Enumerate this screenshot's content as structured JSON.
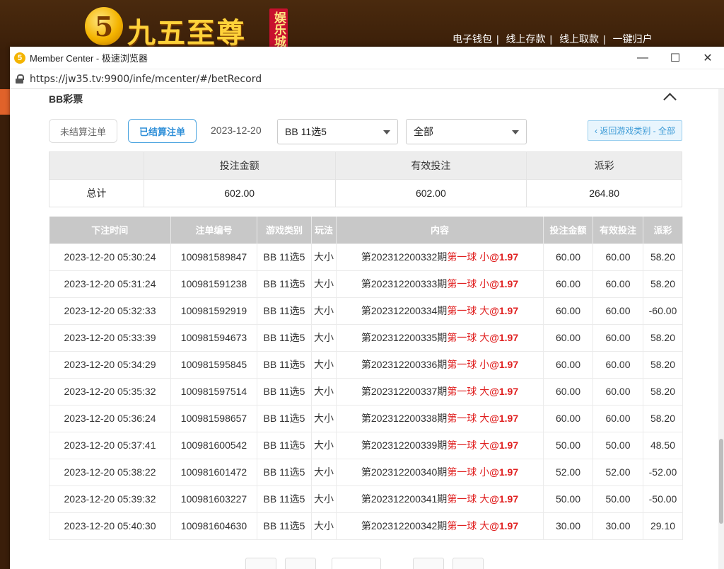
{
  "site": {
    "logo_text": "九五至尊",
    "logo_badge": "娱乐城",
    "nav": [
      "电子钱包",
      "线上存款",
      "线上取款",
      "一键归户"
    ]
  },
  "window": {
    "title": "Member Center - 极速浏览器",
    "url": "https://jw35.tv:9900/infe/mcenter/#/betRecord"
  },
  "section": {
    "title": "BB彩票"
  },
  "filters": {
    "unsettled_label": "未结算注单",
    "settled_label": "已结算注单",
    "date": "2023-12-20",
    "game_select": "BB 11选5",
    "type_select": "全部",
    "back_label": "‹ 返回游戏类别 - 全部"
  },
  "summary": {
    "headers": [
      "投注金额",
      "有效投注",
      "派彩"
    ],
    "row_label": "总计",
    "values": [
      "602.00",
      "602.00",
      "264.80"
    ]
  },
  "records": {
    "headers": [
      "下注时间",
      "注单编号",
      "游戏类别",
      "玩法",
      "内容",
      "投注金额",
      "有效投注",
      "派彩"
    ],
    "rows": [
      {
        "time": "2023-12-20 05:30:24",
        "id": "100981589847",
        "game": "BB 11选5",
        "play": "大小",
        "period": "第202312200332期",
        "pick": "第一球 小",
        "odds": "@1.97",
        "bet": "60.00",
        "valid": "60.00",
        "payout": "58.20",
        "negative": false
      },
      {
        "time": "2023-12-20 05:31:24",
        "id": "100981591238",
        "game": "BB 11选5",
        "play": "大小",
        "period": "第202312200333期",
        "pick": "第一球 小",
        "odds": "@1.97",
        "bet": "60.00",
        "valid": "60.00",
        "payout": "58.20",
        "negative": false
      },
      {
        "time": "2023-12-20 05:32:33",
        "id": "100981592919",
        "game": "BB 11选5",
        "play": "大小",
        "period": "第202312200334期",
        "pick": "第一球 大",
        "odds": "@1.97",
        "bet": "60.00",
        "valid": "60.00",
        "payout": "-60.00",
        "negative": true
      },
      {
        "time": "2023-12-20 05:33:39",
        "id": "100981594673",
        "game": "BB 11选5",
        "play": "大小",
        "period": "第202312200335期",
        "pick": "第一球 大",
        "odds": "@1.97",
        "bet": "60.00",
        "valid": "60.00",
        "payout": "58.20",
        "negative": false
      },
      {
        "time": "2023-12-20 05:34:29",
        "id": "100981595845",
        "game": "BB 11选5",
        "play": "大小",
        "period": "第202312200336期",
        "pick": "第一球 小",
        "odds": "@1.97",
        "bet": "60.00",
        "valid": "60.00",
        "payout": "58.20",
        "negative": false
      },
      {
        "time": "2023-12-20 05:35:32",
        "id": "100981597514",
        "game": "BB 11选5",
        "play": "大小",
        "period": "第202312200337期",
        "pick": "第一球 大",
        "odds": "@1.97",
        "bet": "60.00",
        "valid": "60.00",
        "payout": "58.20",
        "negative": false
      },
      {
        "time": "2023-12-20 05:36:24",
        "id": "100981598657",
        "game": "BB 11选5",
        "play": "大小",
        "period": "第202312200338期",
        "pick": "第一球 大",
        "odds": "@1.97",
        "bet": "60.00",
        "valid": "60.00",
        "payout": "58.20",
        "negative": false
      },
      {
        "time": "2023-12-20 05:37:41",
        "id": "100981600542",
        "game": "BB 11选5",
        "play": "大小",
        "period": "第202312200339期",
        "pick": "第一球 大",
        "odds": "@1.97",
        "bet": "50.00",
        "valid": "50.00",
        "payout": "48.50",
        "negative": false
      },
      {
        "time": "2023-12-20 05:38:22",
        "id": "100981601472",
        "game": "BB 11选5",
        "play": "大小",
        "period": "第202312200340期",
        "pick": "第一球 小",
        "odds": "@1.97",
        "bet": "52.00",
        "valid": "52.00",
        "payout": "-52.00",
        "negative": true
      },
      {
        "time": "2023-12-20 05:39:32",
        "id": "100981603227",
        "game": "BB 11选5",
        "play": "大小",
        "period": "第202312200341期",
        "pick": "第一球 大",
        "odds": "@1.97",
        "bet": "50.00",
        "valid": "50.00",
        "payout": "-50.00",
        "negative": true
      },
      {
        "time": "2023-12-20 05:40:30",
        "id": "100981604630",
        "game": "BB 11选5",
        "play": "大小",
        "period": "第202312200342期",
        "pick": "第一球 大",
        "odds": "@1.97",
        "bet": "30.00",
        "valid": "30.00",
        "payout": "29.10",
        "negative": false
      }
    ]
  },
  "colors": {
    "accent": "#2f8fd8",
    "highlight": "#e02020",
    "header_bg": "#c8c8c8"
  },
  "icons": {
    "app": "browser-logo-icon",
    "lock": "lock-icon",
    "collapse": "chevron-up-icon",
    "caret": "caret-down-icon"
  }
}
